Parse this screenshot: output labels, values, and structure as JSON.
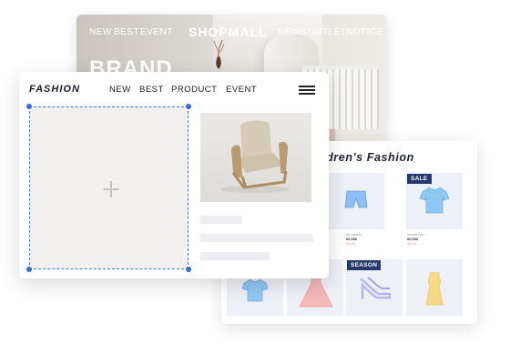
{
  "shop_banner": {
    "nav_left": [
      "NEW",
      "BEST",
      "EVENT"
    ],
    "logo": "SHOPMALL",
    "nav_right": [
      "NEWS",
      "OUTLET",
      "NOTICE"
    ],
    "headline": "BRAND"
  },
  "kids_shop": {
    "title": "ldren's Fashion",
    "badges": [
      "SALE",
      "SEASON"
    ],
    "tile_meta": {
      "top_row": [
        {
          "caption": "",
          "name": "nn nnnnn",
          "price": "00,000",
          "old": "45.00"
        },
        {
          "caption": "",
          "name": "nnnnn nnn",
          "price": "00,000",
          "old": "48.00"
        }
      ]
    },
    "colors": {
      "badge": "#243a6d",
      "tile": "#eef0f7",
      "icon_blue": "#8fc8f3",
      "icon_purple": "#b5b5ef",
      "icon_yellow": "#f5d985",
      "icon_pink": "#f5b8b8"
    }
  },
  "editor": {
    "logo": "FASHION",
    "nav": [
      "NEW",
      "BEST",
      "PRODUCT",
      "EVENT"
    ],
    "menu_icon": "hamburger-icon",
    "drop_zone_icon": "plus-icon",
    "colors": {
      "selection": "#2f6fe0",
      "skeleton": "#eceef2"
    }
  }
}
